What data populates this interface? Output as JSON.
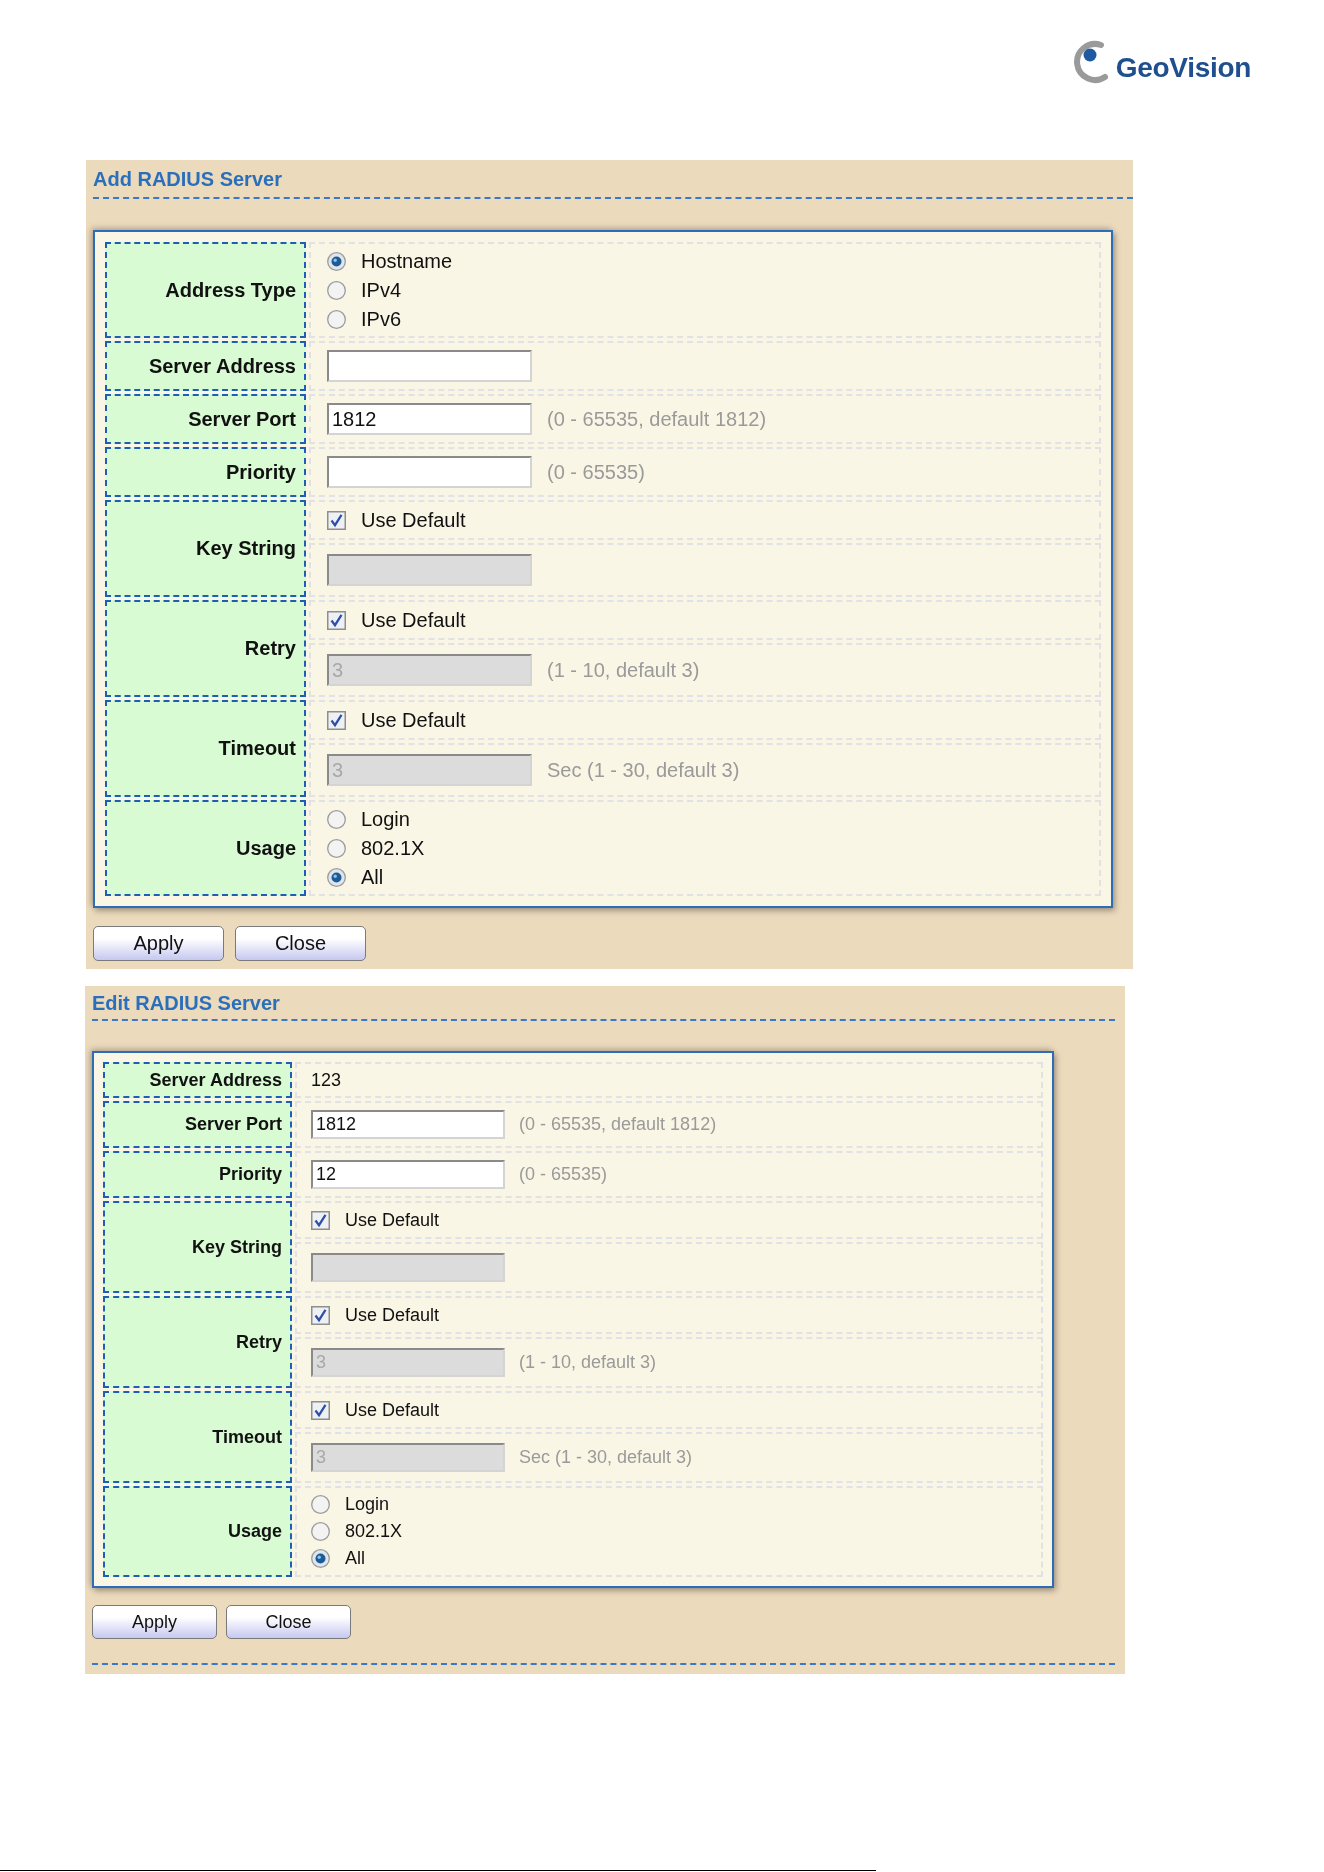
{
  "logo": {
    "text": "GeoVision"
  },
  "panels": [
    {
      "title": "Add RADIUS Server",
      "fields": [
        {
          "kind": "radio",
          "label": "Address Type",
          "options": [
            {
              "label": "Hostname",
              "selected": true
            },
            {
              "label": "IPv4",
              "selected": false
            },
            {
              "label": "IPv6",
              "selected": false
            }
          ]
        },
        {
          "kind": "input",
          "label": "Server Address",
          "input": {
            "disabled": false
          }
        },
        {
          "kind": "input",
          "label": "Server Port",
          "input": {
            "value": "1812",
            "disabled": false
          },
          "hint": "(0 - 65535, default 1812)"
        },
        {
          "kind": "input",
          "label": "Priority",
          "input": {
            "disabled": false
          },
          "hint": "(0 - 65535)"
        },
        {
          "kind": "default",
          "label": "Key String",
          "checkbox": {
            "label": "Use Default",
            "checked": true
          },
          "input": {
            "disabled": true
          }
        },
        {
          "kind": "default",
          "label": "Retry",
          "checkbox": {
            "label": "Use Default",
            "checked": true
          },
          "input": {
            "value": "3",
            "disabled": true
          },
          "hint": "(1 - 10, default 3)"
        },
        {
          "kind": "default",
          "label": "Timeout",
          "checkbox": {
            "label": "Use Default",
            "checked": true
          },
          "input": {
            "value": "3",
            "disabled": true
          },
          "hint": "Sec (1 - 30, default 3)"
        },
        {
          "kind": "radio",
          "label": "Usage",
          "options": [
            {
              "label": "Login",
              "selected": false
            },
            {
              "label": "802.1X",
              "selected": false
            },
            {
              "label": "All",
              "selected": true
            }
          ]
        }
      ],
      "buttons": [
        "Apply",
        "Close"
      ]
    },
    {
      "title": "Edit RADIUS Server",
      "fields": [
        {
          "kind": "text",
          "label": "Server Address",
          "value": "123"
        },
        {
          "kind": "input",
          "label": "Server Port",
          "input": {
            "value": "1812",
            "disabled": false
          },
          "hint": "(0 - 65535, default 1812)"
        },
        {
          "kind": "input",
          "label": "Priority",
          "input": {
            "value": "12",
            "disabled": false
          },
          "hint": "(0 - 65535)"
        },
        {
          "kind": "default",
          "label": "Key String",
          "checkbox": {
            "label": "Use Default",
            "checked": true
          },
          "input": {
            "disabled": true
          }
        },
        {
          "kind": "default",
          "label": "Retry",
          "checkbox": {
            "label": "Use Default",
            "checked": true
          },
          "input": {
            "value": "3",
            "disabled": true
          },
          "hint": "(1 - 10, default 3)"
        },
        {
          "kind": "default",
          "label": "Timeout",
          "checkbox": {
            "label": "Use Default",
            "checked": true
          },
          "input": {
            "value": "3",
            "disabled": true
          },
          "hint": "Sec (1 - 30, default 3)"
        },
        {
          "kind": "radio",
          "label": "Usage",
          "options": [
            {
              "label": "Login",
              "selected": false
            },
            {
              "label": "802.1X",
              "selected": false
            },
            {
              "label": "All",
              "selected": true
            }
          ]
        }
      ],
      "buttons": [
        "Apply",
        "Close"
      ]
    }
  ]
}
